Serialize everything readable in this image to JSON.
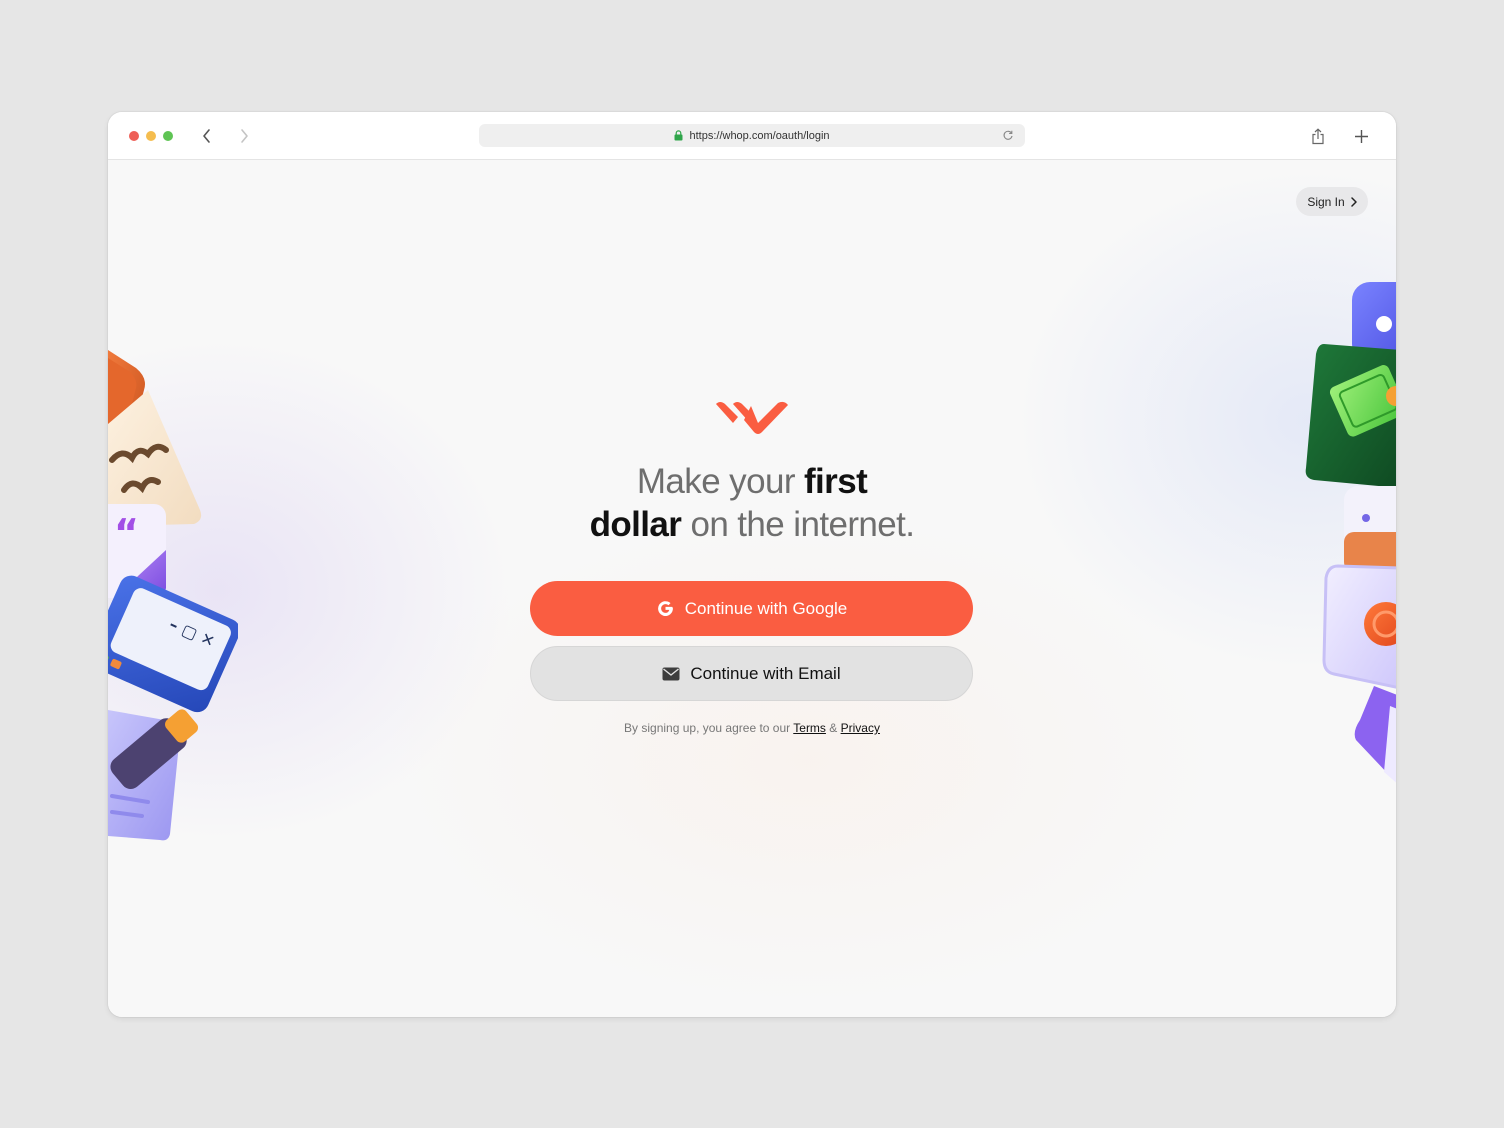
{
  "browser": {
    "url": "https://whop.com/oauth/login"
  },
  "header": {
    "sign_in_label": "Sign In"
  },
  "hero": {
    "line1_light": "Make your ",
    "line1_strong": "first",
    "line2_strong": "dollar",
    "line2_light": " on the internet."
  },
  "auth": {
    "google_label": "Continue with Google",
    "email_label": "Continue with Email"
  },
  "legal": {
    "prefix": "By signing up, you agree to our ",
    "terms": "Terms",
    "separator": " & ",
    "privacy": "Privacy"
  },
  "colors": {
    "brand": "#fa5d41",
    "email_button": "#e2e2e2"
  },
  "icons": {
    "logo": "whop-logo",
    "google": "google-icon",
    "email": "envelope-icon"
  }
}
